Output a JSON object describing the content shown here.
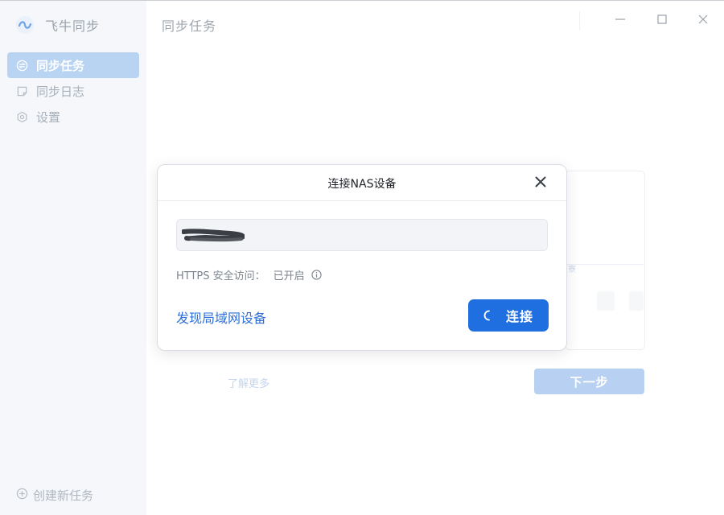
{
  "app": {
    "name": "飞牛同步"
  },
  "sidebar": {
    "items": [
      {
        "label": "同步任务",
        "icon": "sync-task-icon",
        "active": true
      },
      {
        "label": "同步日志",
        "icon": "log-icon",
        "active": false
      },
      {
        "label": "设置",
        "icon": "settings-icon",
        "active": false
      }
    ],
    "create_label": "创建新任务"
  },
  "main": {
    "title": "同步任务",
    "learn_more": "了解更多",
    "next_label": "下一步",
    "bg_deco_text": "寮"
  },
  "window_controls": [
    "minimize",
    "maximize",
    "close"
  ],
  "modal": {
    "title": "连接NAS设备",
    "address_value": "",
    "https_label": "HTTPS 安全访问：",
    "https_status": "已开启",
    "discover_label": "发现局域网设备",
    "connect_label": "连接"
  },
  "colors": {
    "accent": "#1f6fe0",
    "active_nav_bg": "#b9d3f3",
    "link": "#2d6fd4"
  }
}
